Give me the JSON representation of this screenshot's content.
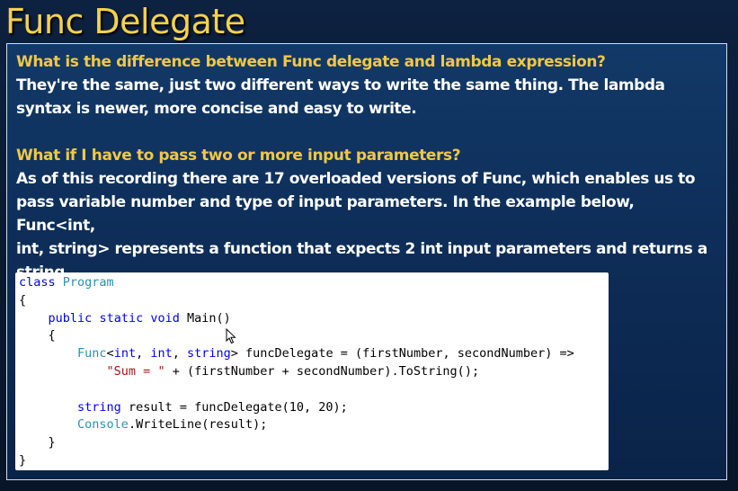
{
  "slide": {
    "title": "Func Delegate"
  },
  "qa": [
    {
      "question": "What is the difference between Func delegate and lambda expression?",
      "answer_lines": [
        "They're the same, just two different ways to write the same thing. The lambda",
        "syntax is newer, more concise and easy to write."
      ]
    },
    {
      "question": "What if I have to pass two or more input parameters?",
      "answer_lines": [
        "As of this recording there are 17 overloaded versions of Func, which enables us to",
        "pass variable number and type of input parameters. In the example below, Func<int,",
        "int, string> represents a function that expects 2 int input parameters and returns a",
        "string."
      ]
    }
  ],
  "code": {
    "l1": {
      "kw": "class",
      "sp": " ",
      "type": "Program"
    },
    "l2": "{",
    "l3": {
      "indent": "    ",
      "kw1": "public",
      "kw2": "static",
      "kw3": "void",
      "rest": " Main()"
    },
    "l4": "    {",
    "l5": {
      "indent": "        ",
      "type": "Func",
      "lt": "<",
      "kw1": "int",
      "c1": ", ",
      "kw2": "int",
      "c2": ", ",
      "kw3": "string",
      "rest": "> funcDelegate = (firstNumber, secondNumber) =>"
    },
    "l6": {
      "indent": "            ",
      "str": "\"Sum = \"",
      "rest": " + (firstNumber + secondNumber).ToString();"
    },
    "l7": "",
    "l8": {
      "indent": "        ",
      "kw": "string",
      "rest": " result = funcDelegate(10, 20);"
    },
    "l9": {
      "indent": "        ",
      "type": "Console",
      "rest": ".WriteLine(result);"
    },
    "l10": "    }",
    "l11": "}"
  }
}
